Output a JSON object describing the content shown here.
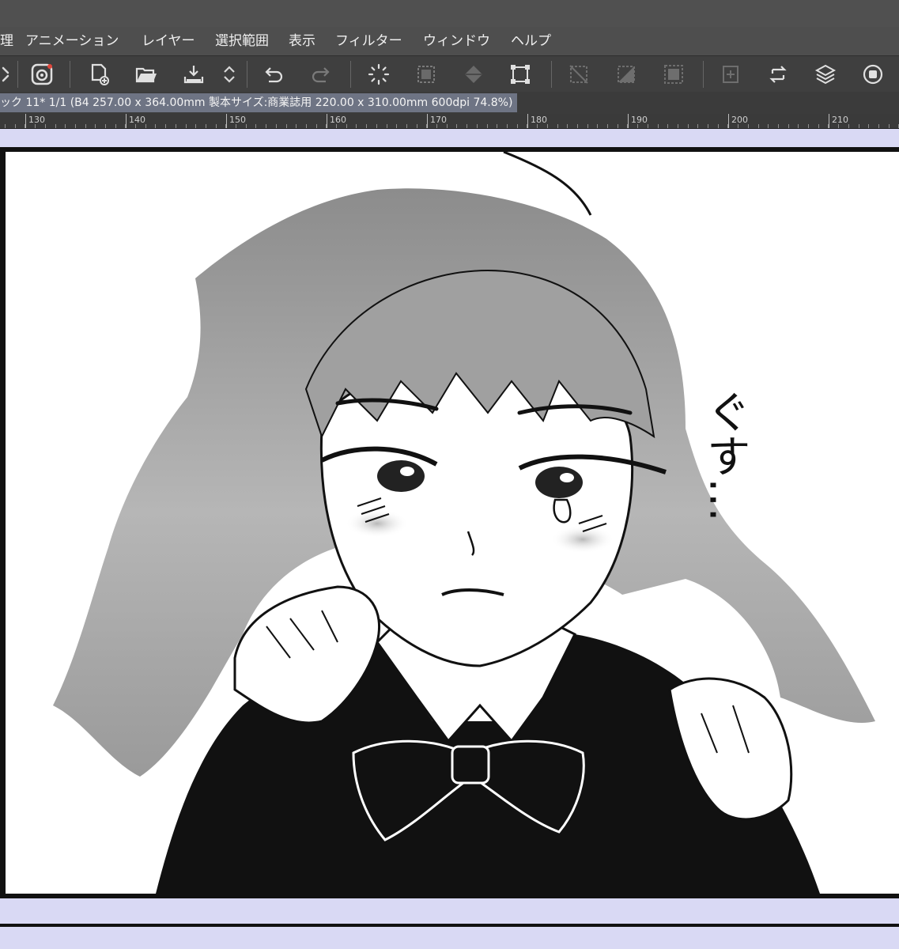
{
  "menu": {
    "items": [
      "理",
      "アニメーション",
      "レイヤー",
      "選択範囲",
      "表示",
      "フィルター",
      "ウィンドウ",
      "ヘルプ"
    ]
  },
  "toolbar": {
    "icons": [
      "chevron-icon",
      "clip-studio-icon",
      "new-document-icon",
      "open-folder-icon",
      "save-icon",
      "up-down-icon",
      "undo-icon",
      "redo-icon",
      "loading-icon",
      "select-all-icon",
      "fill-icon",
      "transform-icon",
      "clear-selection-icon",
      "invert-selection-icon",
      "selection-border-icon",
      "crop-icon",
      "swap-icon",
      "layers-icon",
      "mask-icon"
    ]
  },
  "canvas": {
    "info": "ック 11* 1/1 (B4 257.00 x 364.00mm 製本サイズ:商業誌用 220.00 x 310.00mm 600dpi 74.8%)"
  },
  "ruler": {
    "labels": [
      "130",
      "140",
      "150",
      "160",
      "170",
      "180",
      "190",
      "200",
      "210"
    ]
  },
  "artwork": {
    "sfx_text": "ぐす…",
    "colors": {
      "ink": "#111111",
      "paper": "#ffffff",
      "tone": "#a8a8a8",
      "margin": "#d9d9f4"
    }
  }
}
